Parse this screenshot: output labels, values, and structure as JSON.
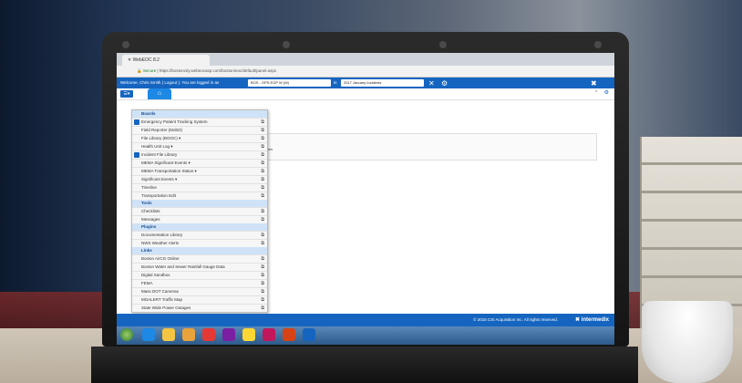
{
  "window": {
    "tab_title": "WebEOC 8.2",
    "secure_label": "Secure",
    "url": "https://bostoncity.webeocasp.com/boston/eoc/default/panel.aspx"
  },
  "topbar": {
    "welcome": "Welcome, Chris Smith ( Logout ). You are logged in as",
    "position": "BOS - OPS EOP W (M)",
    "in_label": "in",
    "incident": "2017 January Incidents"
  },
  "menu": {
    "sections": [
      {
        "title": "Boards",
        "items": [
          {
            "label": "Emergency Patient Tracking System",
            "badge": true
          },
          {
            "label": "Field Reporter (MobO)"
          },
          {
            "label": "File Library (BOOC) ▾"
          },
          {
            "label": "Health Unit Log ▾"
          },
          {
            "label": "Incident File Library",
            "badge": true
          },
          {
            "label": "MEMA Significant Events ▾"
          },
          {
            "label": "MEMA Transportation Status ▾"
          },
          {
            "label": "Significant Events ▾"
          },
          {
            "label": "Timeline"
          },
          {
            "label": "Transportation Edit"
          }
        ]
      },
      {
        "title": "Tools",
        "items": [
          {
            "label": "Checklists"
          },
          {
            "label": "Messages"
          }
        ]
      },
      {
        "title": "Plugins",
        "items": [
          {
            "label": "Documentation Library"
          },
          {
            "label": "NWS Weather Alerts"
          }
        ]
      },
      {
        "title": "Links",
        "items": [
          {
            "label": "Boston AirCG Online"
          },
          {
            "label": "Boston Water and Sewer Rainfall Gauge Data"
          },
          {
            "label": "Digital Sandbox"
          },
          {
            "label": "FEMA"
          },
          {
            "label": "Mass DOT Cameras"
          },
          {
            "label": "MOALERT Traffic Map"
          },
          {
            "label": "State Wide Power Outages"
          }
        ]
      }
    ]
  },
  "content": {
    "text": "files"
  },
  "footer": {
    "copyright": "© 2016 CSI Acquisition Inc. All rights reserved.",
    "brand": "intermedix"
  }
}
